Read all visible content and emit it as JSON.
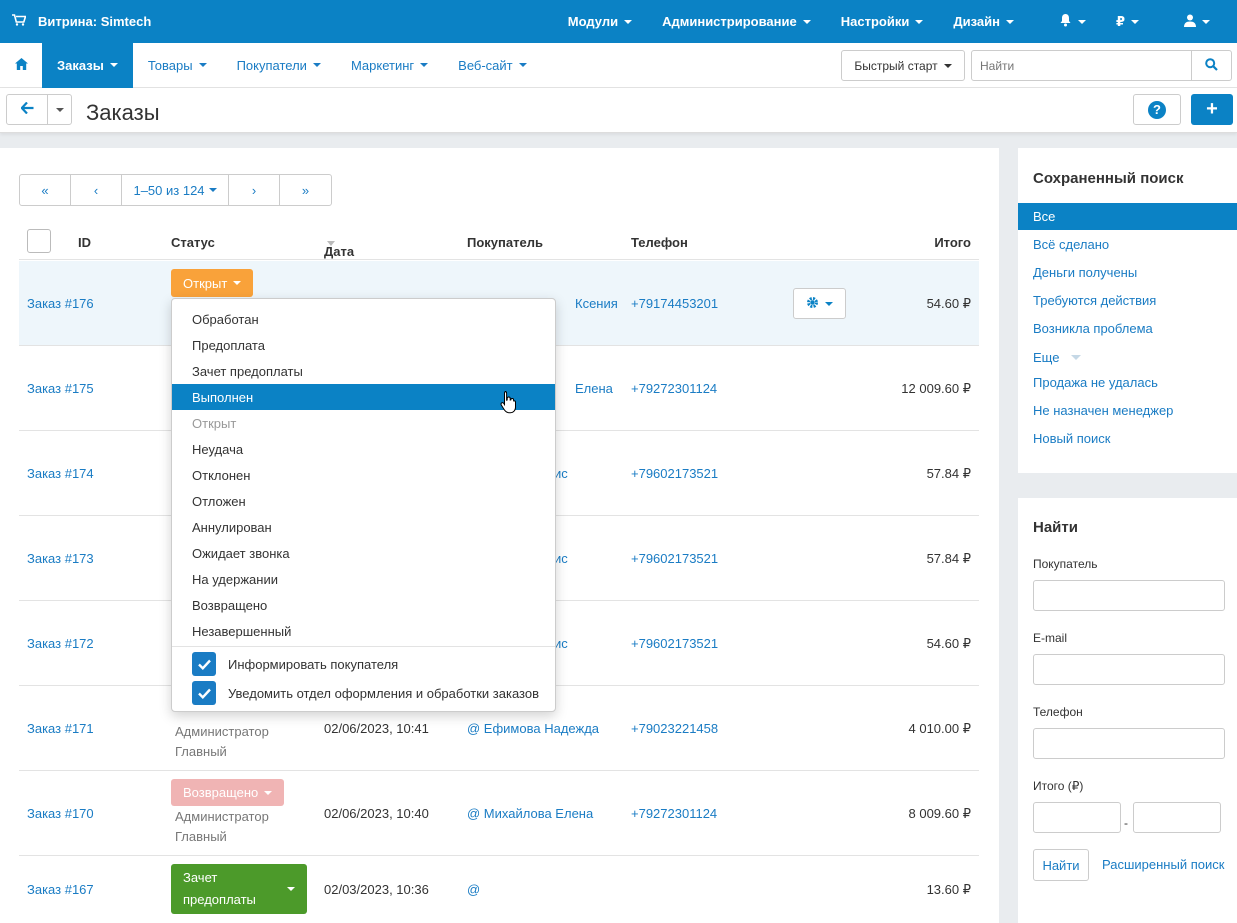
{
  "topbar": {
    "store": "Витрина: Simtech",
    "menu": [
      "Модули",
      "Администрирование",
      "Настройки",
      "Дизайн"
    ],
    "currency": "₽"
  },
  "nav": {
    "tabs": [
      "Заказы",
      "Товары",
      "Покупатели",
      "Маркетинг",
      "Веб-сайт"
    ],
    "quickstart": "Быстрый старт",
    "search_placeholder": "Найти"
  },
  "page": {
    "title": "Заказы"
  },
  "pager": {
    "first": "«",
    "prev": "‹",
    "range": "1–50 из 124",
    "next": "›",
    "last": "»"
  },
  "table": {
    "headers": {
      "id": "ID",
      "status": "Статус",
      "date": "Дата",
      "customer": "Покупатель",
      "phone": "Телефон",
      "total": "Итого"
    },
    "rows": [
      {
        "order": "Заказ #176",
        "status": "Открыт",
        "customer": "Ксения",
        "phone": "+79174453201",
        "total": "54.60 ₽"
      },
      {
        "order": "Заказ #175",
        "customer": "Елена",
        "phone": "+79272301124",
        "total": "12 009.60 ₽"
      },
      {
        "order": "Заказ #174",
        "customer": "ис",
        "phone": "+79602173521",
        "total": "57.84 ₽"
      },
      {
        "order": "Заказ #173",
        "customer": "ис",
        "phone": "+79602173521",
        "total": "57.84 ₽"
      },
      {
        "order": "Заказ #172",
        "customer": "ис",
        "phone": "+79602173521",
        "total": "54.60 ₽"
      },
      {
        "order": "Заказ #171",
        "admin1": "Администратор",
        "admin2": "Главный",
        "date": "02/06/2023, 10:41",
        "customer": "@ Ефимова Надежда",
        "phone": "+79023221458",
        "total": "4 010.00 ₽"
      },
      {
        "order": "Заказ #170",
        "status": "Возвращено",
        "admin1": "Администратор",
        "admin2": "Главный",
        "date": "02/06/2023, 10:40",
        "customer": "@ Михайлова Елена",
        "phone": "+79272301124",
        "total": "8 009.60 ₽"
      },
      {
        "order": "Заказ #167",
        "status1": "Зачет",
        "status2": "предоплаты",
        "date": "02/03/2023, 10:36",
        "customer": "@",
        "phone": "",
        "total": "13.60 ₽"
      }
    ]
  },
  "dropdown": {
    "items": [
      "Обработан",
      "Предоплата",
      "Зачет предоплаты",
      "Выполнен",
      "Открыт",
      "Неудача",
      "Отклонен",
      "Отложен",
      "Аннулирован",
      "Ожидает звонка",
      "На удержании",
      "Возвращено",
      "Незавершенный"
    ],
    "notify_customer": "Информировать покупателя",
    "notify_dept": "Уведомить отдел оформления и обработки заказов"
  },
  "saved_search": {
    "title": "Сохраненный поиск",
    "items": [
      "Все",
      "Всё сделано",
      "Деньги получены",
      "Требуются действия",
      "Возникла проблема",
      "Еще",
      "Продажа не удалась",
      "Не назначен менеджер",
      "Новый поиск"
    ]
  },
  "find": {
    "title": "Найти",
    "customer": "Покупатель",
    "email": "E-mail",
    "phone": "Телефон",
    "total": "Итого (₽)",
    "dash": "-",
    "button": "Найти",
    "advanced": "Расширенный поиск"
  },
  "colors": {
    "primary": "#0b82c5",
    "open": "#f9a23a",
    "returned": "#f0b4b4",
    "green": "#4c9a2a",
    "greenLight": "#8fcb62"
  }
}
